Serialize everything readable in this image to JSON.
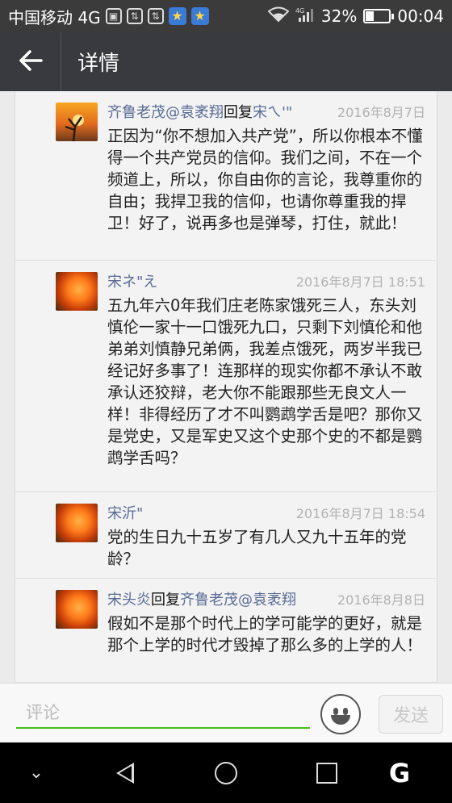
{
  "status_bar": {
    "carrier": "中国移动 4G",
    "network_type": "4G",
    "battery": "32%",
    "battery_level": 0.32,
    "time": "00:04"
  },
  "header": {
    "back_icon": "arrow-left-icon",
    "title": "详情"
  },
  "comments": [
    {
      "avatar": "sunset-tree",
      "author": "齐鲁老茂@袁袤翔",
      "reply_word": "回复",
      "reply_to": "宋ㄟ'\"",
      "time": "2016年8月7日",
      "text": "正因为“你不想加入共产党”，所以你根本不懂得一个共产党员的信仰。我们之间，不在一个频道上，所以，你自由你的言论，我尊重你的自由；我捍卫我的信仰，也请你尊重我的捍卫！好了，说再多也是弹琴，打住，就此！"
    },
    {
      "avatar": "orange-flower",
      "author": "宋ネ\"え",
      "reply_word": "",
      "reply_to": "",
      "time": "2016年8月7日 18:51",
      "text": "五九年六0年我们庄老陈家饿死三人，东头刘慎伦一家十一口饿死九口，只剩下刘慎伦和他弟弟刘慎静兄弟俩，我差点饿死，两岁半我已经记好多事了！连那样的现实你都不承认不敢承认还狡辩，老大你不能跟那些无良文人一样！非得经历了才不叫鹦鹉学舌是吧？那你又是党史，又是军史又这个史那个史的不都是鹦鹉学舌吗？"
    },
    {
      "avatar": "orange-flower",
      "author": "宋沂\"",
      "reply_word": "",
      "reply_to": "",
      "time": "2016年8月7日 18:54",
      "text": "党的生日九十五岁了有几人又九十五年的党龄？"
    },
    {
      "avatar": "orange-flower",
      "author": "宋头炎",
      "reply_word": "回复",
      "reply_to": "齐鲁老茂@袁袤翔",
      "time": "2016年8月8日",
      "text": "假如不是那个时代上的学可能学的更好，就是那个上学的时代才毁掉了那么多的上学的人！"
    }
  ],
  "input_bar": {
    "placeholder": "评论",
    "emoji_icon": "smiley-icon",
    "send_label": "发送"
  },
  "nav_bar": {
    "items": [
      "chevron-down-icon",
      "back-triangle-icon",
      "home-circle-icon",
      "recents-square-icon",
      "google-g-icon"
    ],
    "g_label": "G"
  }
}
